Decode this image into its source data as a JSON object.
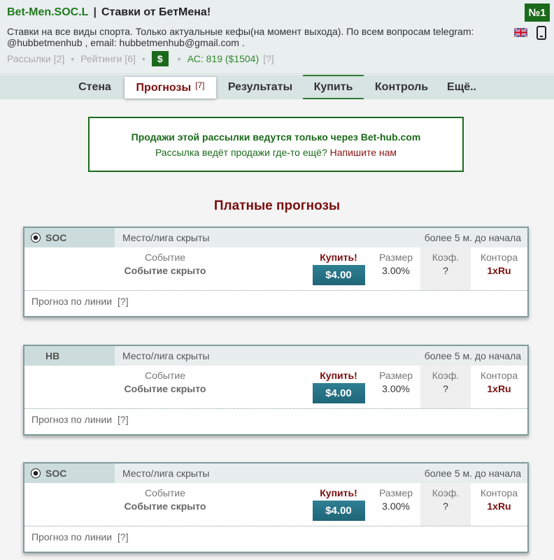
{
  "header": {
    "name": "Bet-Men.SOC.L",
    "separator": "|",
    "subtitle": "Ставки от БетМена!",
    "rank": "№1",
    "description": "Ставки на все виды спорта. Только актуальные кефы(на момент выхода). По всем вопросам telegram: @hubbetmenhub , email: hubbetmenhub@gmail.com .",
    "mailings": "Рассылки [2]",
    "ratings": "Рейтинги [6]",
    "dot": "•",
    "dollar": "$",
    "ac": "АС: 819 ($1504)",
    "ac_help": "[?]"
  },
  "nav": {
    "tabs": [
      "Стена",
      "Прогнозы",
      "Результаты",
      "Купить",
      "Контроль",
      "Ещё.."
    ],
    "forecast_count": "[7]"
  },
  "notice": {
    "line1": "Продажи этой рассылки ведутся только через Bet-hub.com",
    "line2_text": "Рассылка ведёт продажи где-то ещё?",
    "line2_link": "Напишите нам"
  },
  "section_title": "Платные прогнозы",
  "cards": [
    {
      "sport": "SOC",
      "has_ball": true,
      "league": "Место/лига скрыты",
      "time": "более 5 м. до начала",
      "event_label": "Событие",
      "event_value": "Событие скрыто",
      "buy_label": "Купить!",
      "price": "$4.00",
      "size_label": "Размер",
      "size_value": "3.00%",
      "coef_label": "Коэф.",
      "coef_value": "?",
      "book_label": "Контора",
      "book_value": "1xRu",
      "line_label": "Прогноз по линии",
      "line_help": "[?]"
    },
    {
      "sport": "HB",
      "has_ball": false,
      "league": "Место/лига скрыты",
      "time": "более 5 м. до начала",
      "event_label": "Событие",
      "event_value": "Событие скрыто",
      "buy_label": "Купить!",
      "price": "$4.00",
      "size_label": "Размер",
      "size_value": "3.00%",
      "coef_label": "Коэф.",
      "coef_value": "?",
      "book_label": "Контора",
      "book_value": "1xRu",
      "line_label": "Прогноз по линии",
      "line_help": "[?]"
    },
    {
      "sport": "SOC",
      "has_ball": true,
      "league": "Место/лига скрыты",
      "time": "более 5 м. до начала",
      "event_label": "Событие",
      "event_value": "Событие скрыто",
      "buy_label": "Купить!",
      "price": "$4.00",
      "size_label": "Размер",
      "size_value": "3.00%",
      "coef_label": "Коэф.",
      "coef_value": "?",
      "book_label": "Контора",
      "book_value": "1xRu",
      "line_label": "Прогноз по линии",
      "line_help": "[?]"
    }
  ],
  "colors": {
    "brand_green": "#1b6a1b",
    "accent_red": "#7a0f0f",
    "price_blue": "#1f6678"
  },
  "icons": {
    "flag": "uk-flag-icon",
    "phone": "mobile-phone-icon",
    "ball": "soccer-ball-icon"
  }
}
